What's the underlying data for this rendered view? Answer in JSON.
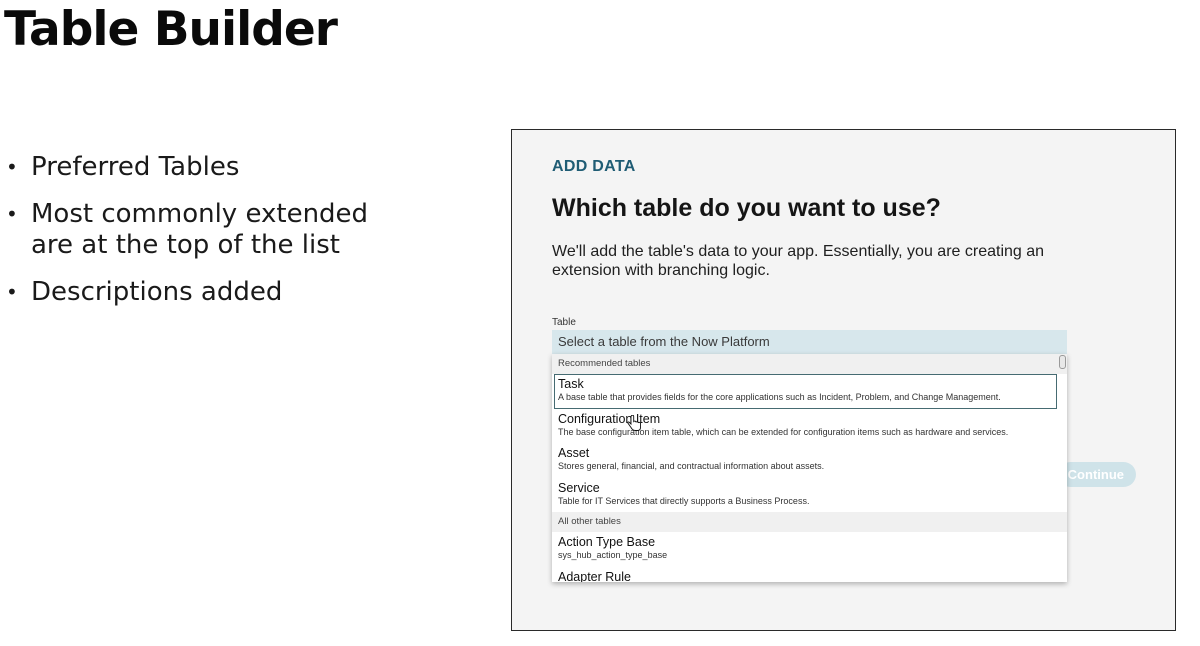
{
  "slide": {
    "title": "Table Builder",
    "bullets": [
      "Preferred Tables",
      "Most commonly extended are at the top of the list",
      "Descriptions added"
    ]
  },
  "dialog": {
    "eyebrow": "ADD DATA",
    "question": "Which table do you want to use?",
    "description": "We'll add the table's data to your app. Essentially, you are creating an extension with branching logic.",
    "field_label": "Table",
    "select_placeholder": "Select a table from the Now Platform",
    "continue_label": "Continue",
    "groups": [
      {
        "header": "Recommended tables",
        "options": [
          {
            "name": "Task",
            "description": "A base table that provides fields for the core applications such as Incident, Problem, and Change Management.",
            "highlighted": true
          },
          {
            "name": "Configuration Item",
            "description": "The base configuration item table, which can be extended for configuration items such as hardware and services."
          },
          {
            "name": "Asset",
            "description": "Stores general, financial, and contractual information about assets."
          },
          {
            "name": "Service",
            "description": "Table for IT Services that directly supports a Business Process."
          }
        ]
      },
      {
        "header": "All other tables",
        "options": [
          {
            "name": "Action Type Base",
            "description": "sys_hub_action_type_base"
          },
          {
            "name": "Adapter Rule",
            "description": ""
          }
        ]
      }
    ]
  },
  "colors": {
    "eyebrow": "#1f5c74",
    "select_bg": "#d7e7ec",
    "continue_bg": "#cfe3e9",
    "highlight_border": "#466b72"
  }
}
